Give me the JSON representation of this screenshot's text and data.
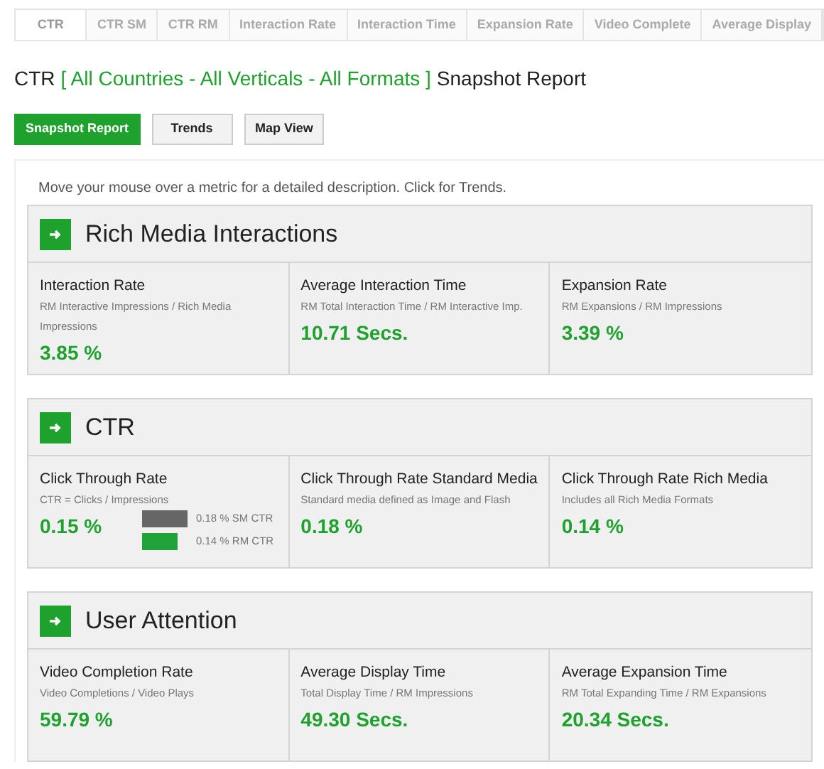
{
  "tabs": [
    {
      "label": "CTR",
      "selected": true
    },
    {
      "label": "CTR SM",
      "selected": false
    },
    {
      "label": "CTR RM",
      "selected": false
    },
    {
      "label": "Interaction Rate",
      "selected": false
    },
    {
      "label": "Interaction Time",
      "selected": false
    },
    {
      "label": "Expansion Rate",
      "selected": false
    },
    {
      "label": "Video Complete",
      "selected": false
    },
    {
      "label": "Average Display",
      "selected": false
    }
  ],
  "title": {
    "metric": "CTR",
    "filter": "[ All Countries - All Verticals - All Formats ]",
    "suffix": "Snapshot Report"
  },
  "view_buttons": [
    {
      "label": "Snapshot Report",
      "selected": true
    },
    {
      "label": "Trends",
      "selected": false
    },
    {
      "label": "Map View",
      "selected": false
    }
  ],
  "hint": "Move your mouse over a metric for a detailed description. Click for Trends.",
  "sections": [
    {
      "title": "Rich Media Interactions",
      "metrics": [
        {
          "name": "Interaction Rate",
          "formula": "RM Interactive Impressions / Rich Media Impressions",
          "value": "3.85 %"
        },
        {
          "name": "Average Interaction Time",
          "formula": "RM Total Interaction Time / RM Interactive Imp.",
          "value": "10.71 Secs."
        },
        {
          "name": "Expansion Rate",
          "formula": "RM Expansions / RM Impressions",
          "value": "3.39 %"
        }
      ]
    },
    {
      "title": "CTR",
      "metrics": [
        {
          "name": "Click Through Rate",
          "formula": "CTR = Clicks / Impressions",
          "value": "0.15 %",
          "bars": [
            {
              "label": "0.18 % SM CTR",
              "color": "#666666"
            },
            {
              "label": "0.14 % RM CTR",
              "color": "#22a33a"
            }
          ]
        },
        {
          "name": "Click Through Rate Standard Media",
          "formula": "Standard media defined as Image and Flash",
          "value": "0.18 %"
        },
        {
          "name": "Click Through Rate Rich Media",
          "formula": "Includes all Rich Media Formats",
          "value": "0.14 %"
        }
      ]
    },
    {
      "title": "User Attention",
      "metrics": [
        {
          "name": "Video Completion Rate",
          "formula": "Video Completions / Video Plays",
          "value": "59.79 %"
        },
        {
          "name": "Average Display Time",
          "formula": "Total Display Time / RM Impressions",
          "value": "49.30 Secs."
        },
        {
          "name": "Average Expansion Time",
          "formula": "RM Total Expanding Time / RM Expansions",
          "value": "20.34 Secs."
        }
      ]
    }
  ]
}
